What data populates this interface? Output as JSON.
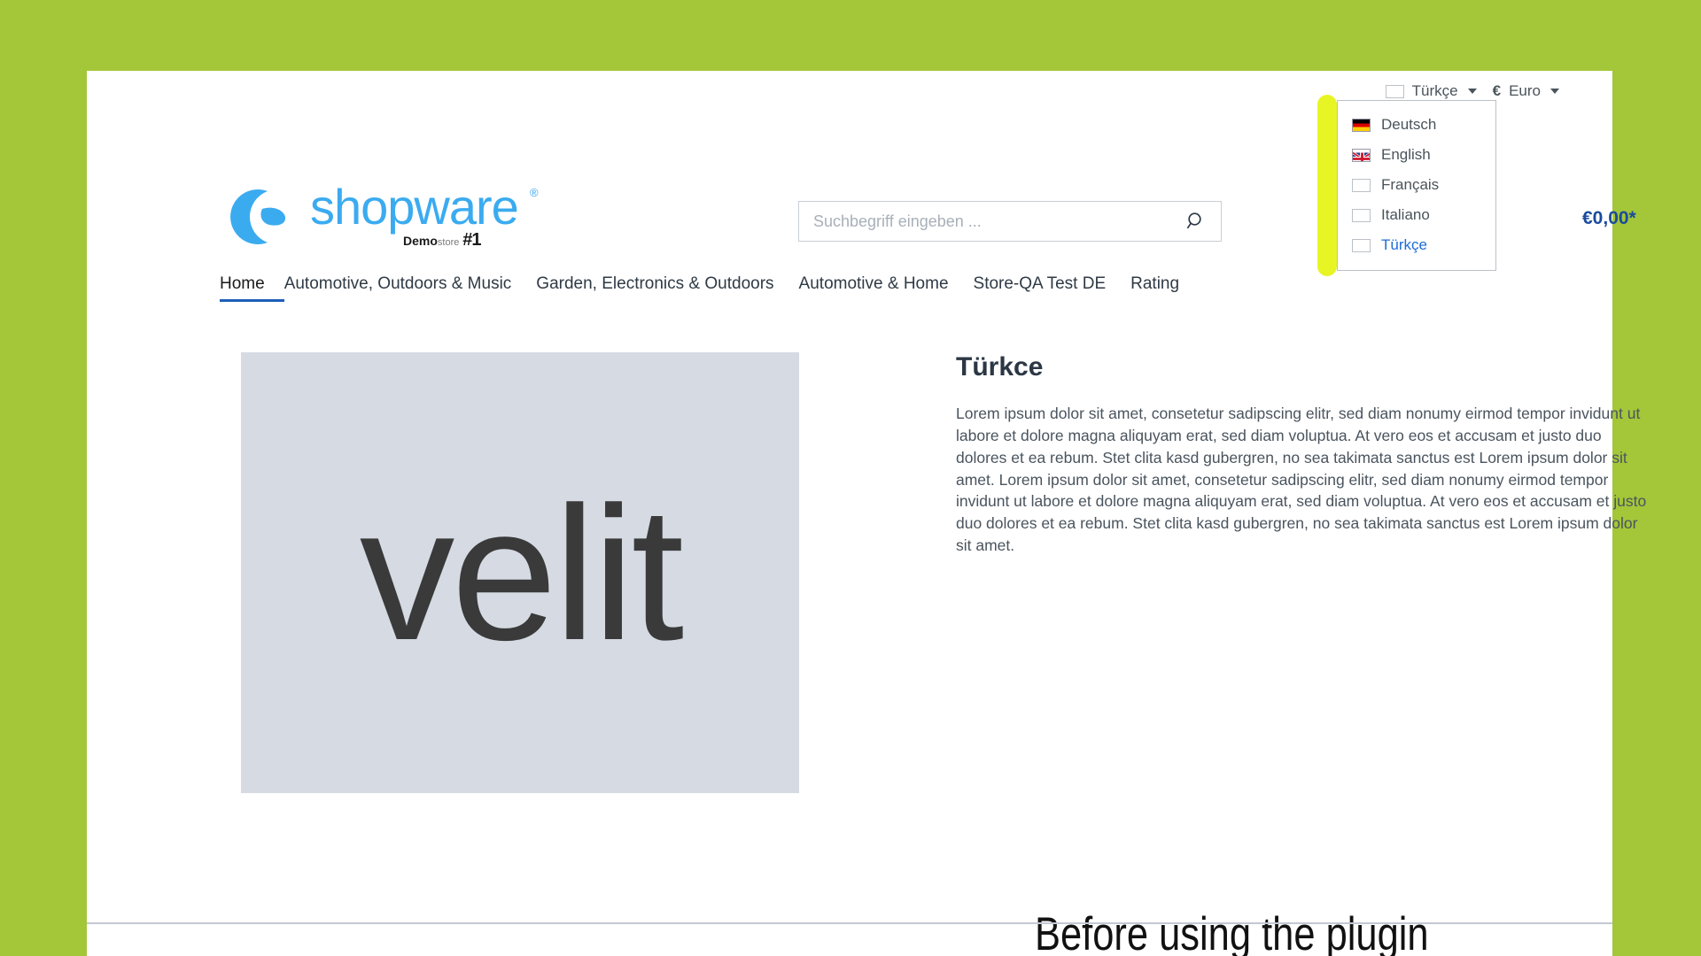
{
  "theme": {
    "background_color": "#a4c639",
    "card_background": "#ffffff",
    "brand_blue": "#3babf0",
    "link_blue": "#1c6dd8",
    "price_blue": "#1a4b9e",
    "highlight_yellow": "#e8f524",
    "placeholder_gray": "#d5dae3"
  },
  "topbar": {
    "language_selector": {
      "label": "Türkçe",
      "icon": "empty-flag-placeholder",
      "caret": "chevron-down-icon"
    },
    "currency_selector": {
      "symbol": "€",
      "label": "Euro",
      "caret": "chevron-down-icon"
    }
  },
  "language_dropdown": {
    "open": true,
    "items": [
      {
        "label": "Deutsch",
        "icon": "flag-de",
        "active": false
      },
      {
        "label": "English",
        "icon": "flag-uk",
        "active": false
      },
      {
        "label": "Français",
        "icon": "empty-flag-placeholder",
        "active": false
      },
      {
        "label": "Italiano",
        "icon": "empty-flag-placeholder",
        "active": false
      },
      {
        "label": "Türkçe",
        "icon": "empty-flag-placeholder",
        "active": true
      }
    ]
  },
  "header": {
    "logo": {
      "wordmark": "shopware",
      "registered": "®",
      "subtitle_demo": "Demo",
      "subtitle_store": "store",
      "subtitle_rank": "#1"
    },
    "search": {
      "placeholder": "Suchbegriff eingeben ...",
      "value": "",
      "icon": "search-icon"
    },
    "cart": {
      "price": "€0,00*"
    }
  },
  "nav": {
    "items": [
      {
        "label": "Home",
        "active": true
      },
      {
        "label": "Automotive, Outdoors & Music",
        "active": false
      },
      {
        "label": "Garden, Electronics & Outdoors",
        "active": false
      },
      {
        "label": "Automotive & Home",
        "active": false
      },
      {
        "label": "Store-QA Test DE",
        "active": false
      },
      {
        "label": "Rating",
        "active": false
      }
    ]
  },
  "main": {
    "product_image_text": "velit",
    "title": "Türkce",
    "body": "Lorem ipsum dolor sit amet, consetetur sadipscing elitr, sed diam nonumy eirmod tempor invidunt ut labore et dolore magna aliquyam erat, sed diam voluptua. At vero eos et accusam et justo duo dolores et ea rebum. Stet clita kasd gubergren, no sea takimata sanctus est Lorem ipsum dolor sit amet. Lorem ipsum dolor sit amet, consetetur sadipscing elitr, sed diam nonumy eirmod tempor invidunt ut labore et dolore magna aliquyam erat, sed diam voluptua. At vero eos et accusam et justo duo dolores et ea rebum. Stet clita kasd gubergren, no sea takimata sanctus est Lorem ipsum dolor sit amet."
  },
  "annotation": {
    "caption": "Before using the plugin",
    "highlight_marker": "yellow-highlight-bar"
  }
}
